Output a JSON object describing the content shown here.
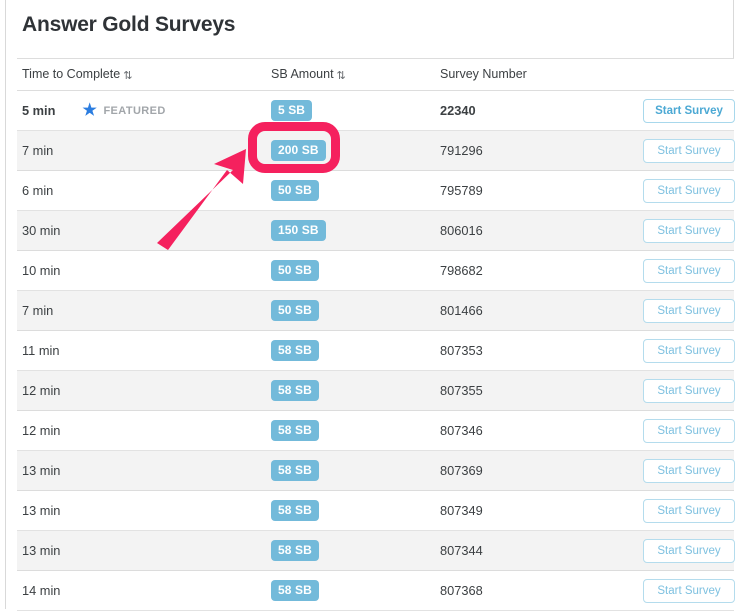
{
  "page": {
    "title": "Answer Gold Surveys"
  },
  "table": {
    "columns": [
      {
        "label": "Time to Complete",
        "sortable": true,
        "sort_glyph": "⇅"
      },
      {
        "label": "SB Amount",
        "sortable": true,
        "sort_glyph": "⇅"
      },
      {
        "label": "Survey Number",
        "sortable": false,
        "sort_glyph": ""
      },
      {
        "label": "",
        "sortable": false,
        "sort_glyph": ""
      }
    ],
    "action_label": "Start Survey",
    "featured_label": "FEATURED",
    "star_glyph": "★",
    "rows": [
      {
        "time": "5 min",
        "featured": true,
        "sb": "5 SB",
        "number": "22340"
      },
      {
        "time": "7 min",
        "featured": false,
        "sb": "200 SB",
        "number": "791296"
      },
      {
        "time": "6 min",
        "featured": false,
        "sb": "50 SB",
        "number": "795789"
      },
      {
        "time": "30 min",
        "featured": false,
        "sb": "150 SB",
        "number": "806016"
      },
      {
        "time": "10 min",
        "featured": false,
        "sb": "50 SB",
        "number": "798682"
      },
      {
        "time": "7 min",
        "featured": false,
        "sb": "50 SB",
        "number": "801466"
      },
      {
        "time": "11 min",
        "featured": false,
        "sb": "58 SB",
        "number": "807353"
      },
      {
        "time": "12 min",
        "featured": false,
        "sb": "58 SB",
        "number": "807355"
      },
      {
        "time": "12 min",
        "featured": false,
        "sb": "58 SB",
        "number": "807346"
      },
      {
        "time": "13 min",
        "featured": false,
        "sb": "58 SB",
        "number": "807369"
      },
      {
        "time": "13 min",
        "featured": false,
        "sb": "58 SB",
        "number": "807349"
      },
      {
        "time": "13 min",
        "featured": false,
        "sb": "58 SB",
        "number": "807344"
      },
      {
        "time": "14 min",
        "featured": false,
        "sb": "58 SB",
        "number": "807368"
      }
    ]
  },
  "annotation": {
    "color": "#f5215e",
    "target_row_index": 1,
    "target_value": "200 SB",
    "shape": "rounded-rectangle-with-arrow"
  },
  "colors": {
    "badge_blue": "#73bada",
    "button_blue": "#7ec1e0",
    "star_blue": "#2b7de0",
    "row_stripe": "#f3f3f3",
    "text": "#3c4043",
    "annotation_pink": "#f5215e"
  }
}
